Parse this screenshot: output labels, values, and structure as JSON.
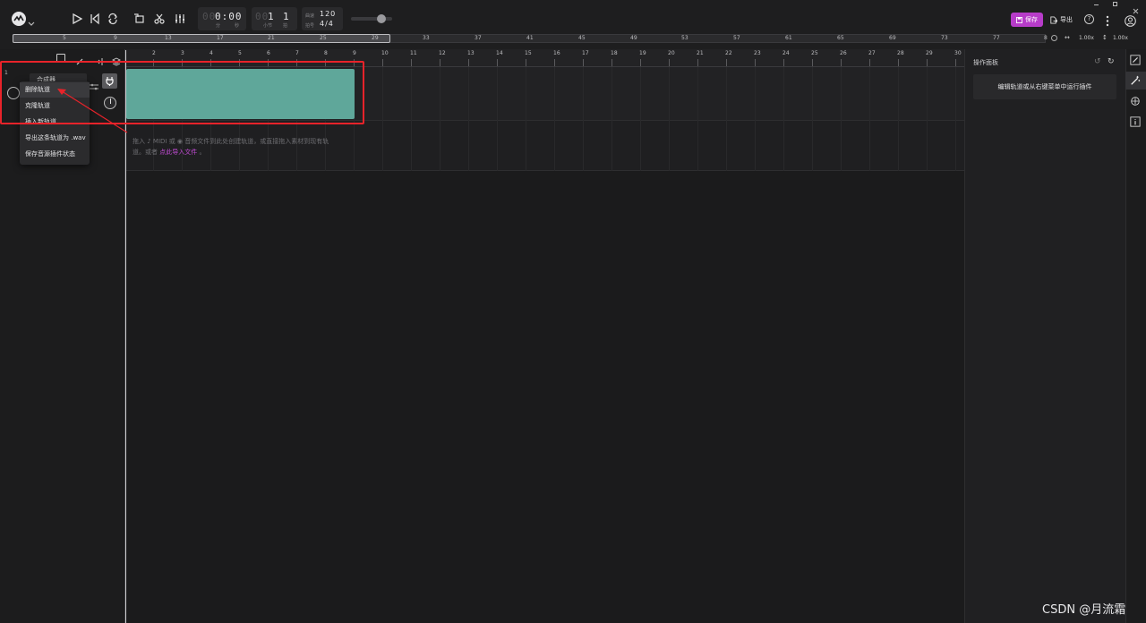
{
  "topbar": {
    "time_display": "0:00",
    "time_dim_prefix": "00",
    "time_unit_min": "分",
    "time_unit_sec": "秒",
    "bar_dim_prefix": "00",
    "bar_value": "1",
    "beat_value": "1",
    "bar_unit": "小节",
    "beat_unit": "拍",
    "tempo_label": "曲速",
    "tempo_value": "120",
    "meter_label": "拍号",
    "meter_value": "4/4",
    "save_label": "保存",
    "export_label": "导出"
  },
  "overview": {
    "numbers": [
      "5",
      "9",
      "13",
      "17",
      "21",
      "25",
      "29",
      "33",
      "37",
      "41",
      "45",
      "49",
      "53",
      "57",
      "61",
      "65",
      "69",
      "73",
      "77",
      "8"
    ],
    "h_zoom": "1.00x",
    "v_zoom": "1.00x"
  },
  "ruler": {
    "bars": [
      "2",
      "3",
      "4",
      "5",
      "6",
      "7",
      "8",
      "9",
      "10",
      "11",
      "12",
      "13",
      "14",
      "15",
      "16",
      "17",
      "18",
      "19",
      "20",
      "21",
      "22",
      "23",
      "24",
      "25",
      "26",
      "27",
      "28",
      "29",
      "30"
    ]
  },
  "track": {
    "number": "1",
    "name_partial": "合成器"
  },
  "context_menu": {
    "items": [
      "删除轨道",
      "克隆轨道",
      "插入新轨道",
      "导出这条轨道为 .wav",
      "保存音源插件状态"
    ]
  },
  "drop_hint": {
    "line1": "拖入 ♪ MIDI 或 ◉ 音频文件到此处创建轨道，或直接拖入素材到现有轨",
    "line2_prefix": "道。或者",
    "line2_link": "点此导入文件",
    "line2_suffix": "。"
  },
  "right_panel": {
    "title": "操作面板",
    "hint": "编辑轨道或从右键菜单中运行插件"
  },
  "watermark": "CSDN @月流霜",
  "colors": {
    "accent": "#b73cc9",
    "clip": "#5fa79a",
    "highlight_box": "#e8232a",
    "link": "#c34bd6"
  }
}
